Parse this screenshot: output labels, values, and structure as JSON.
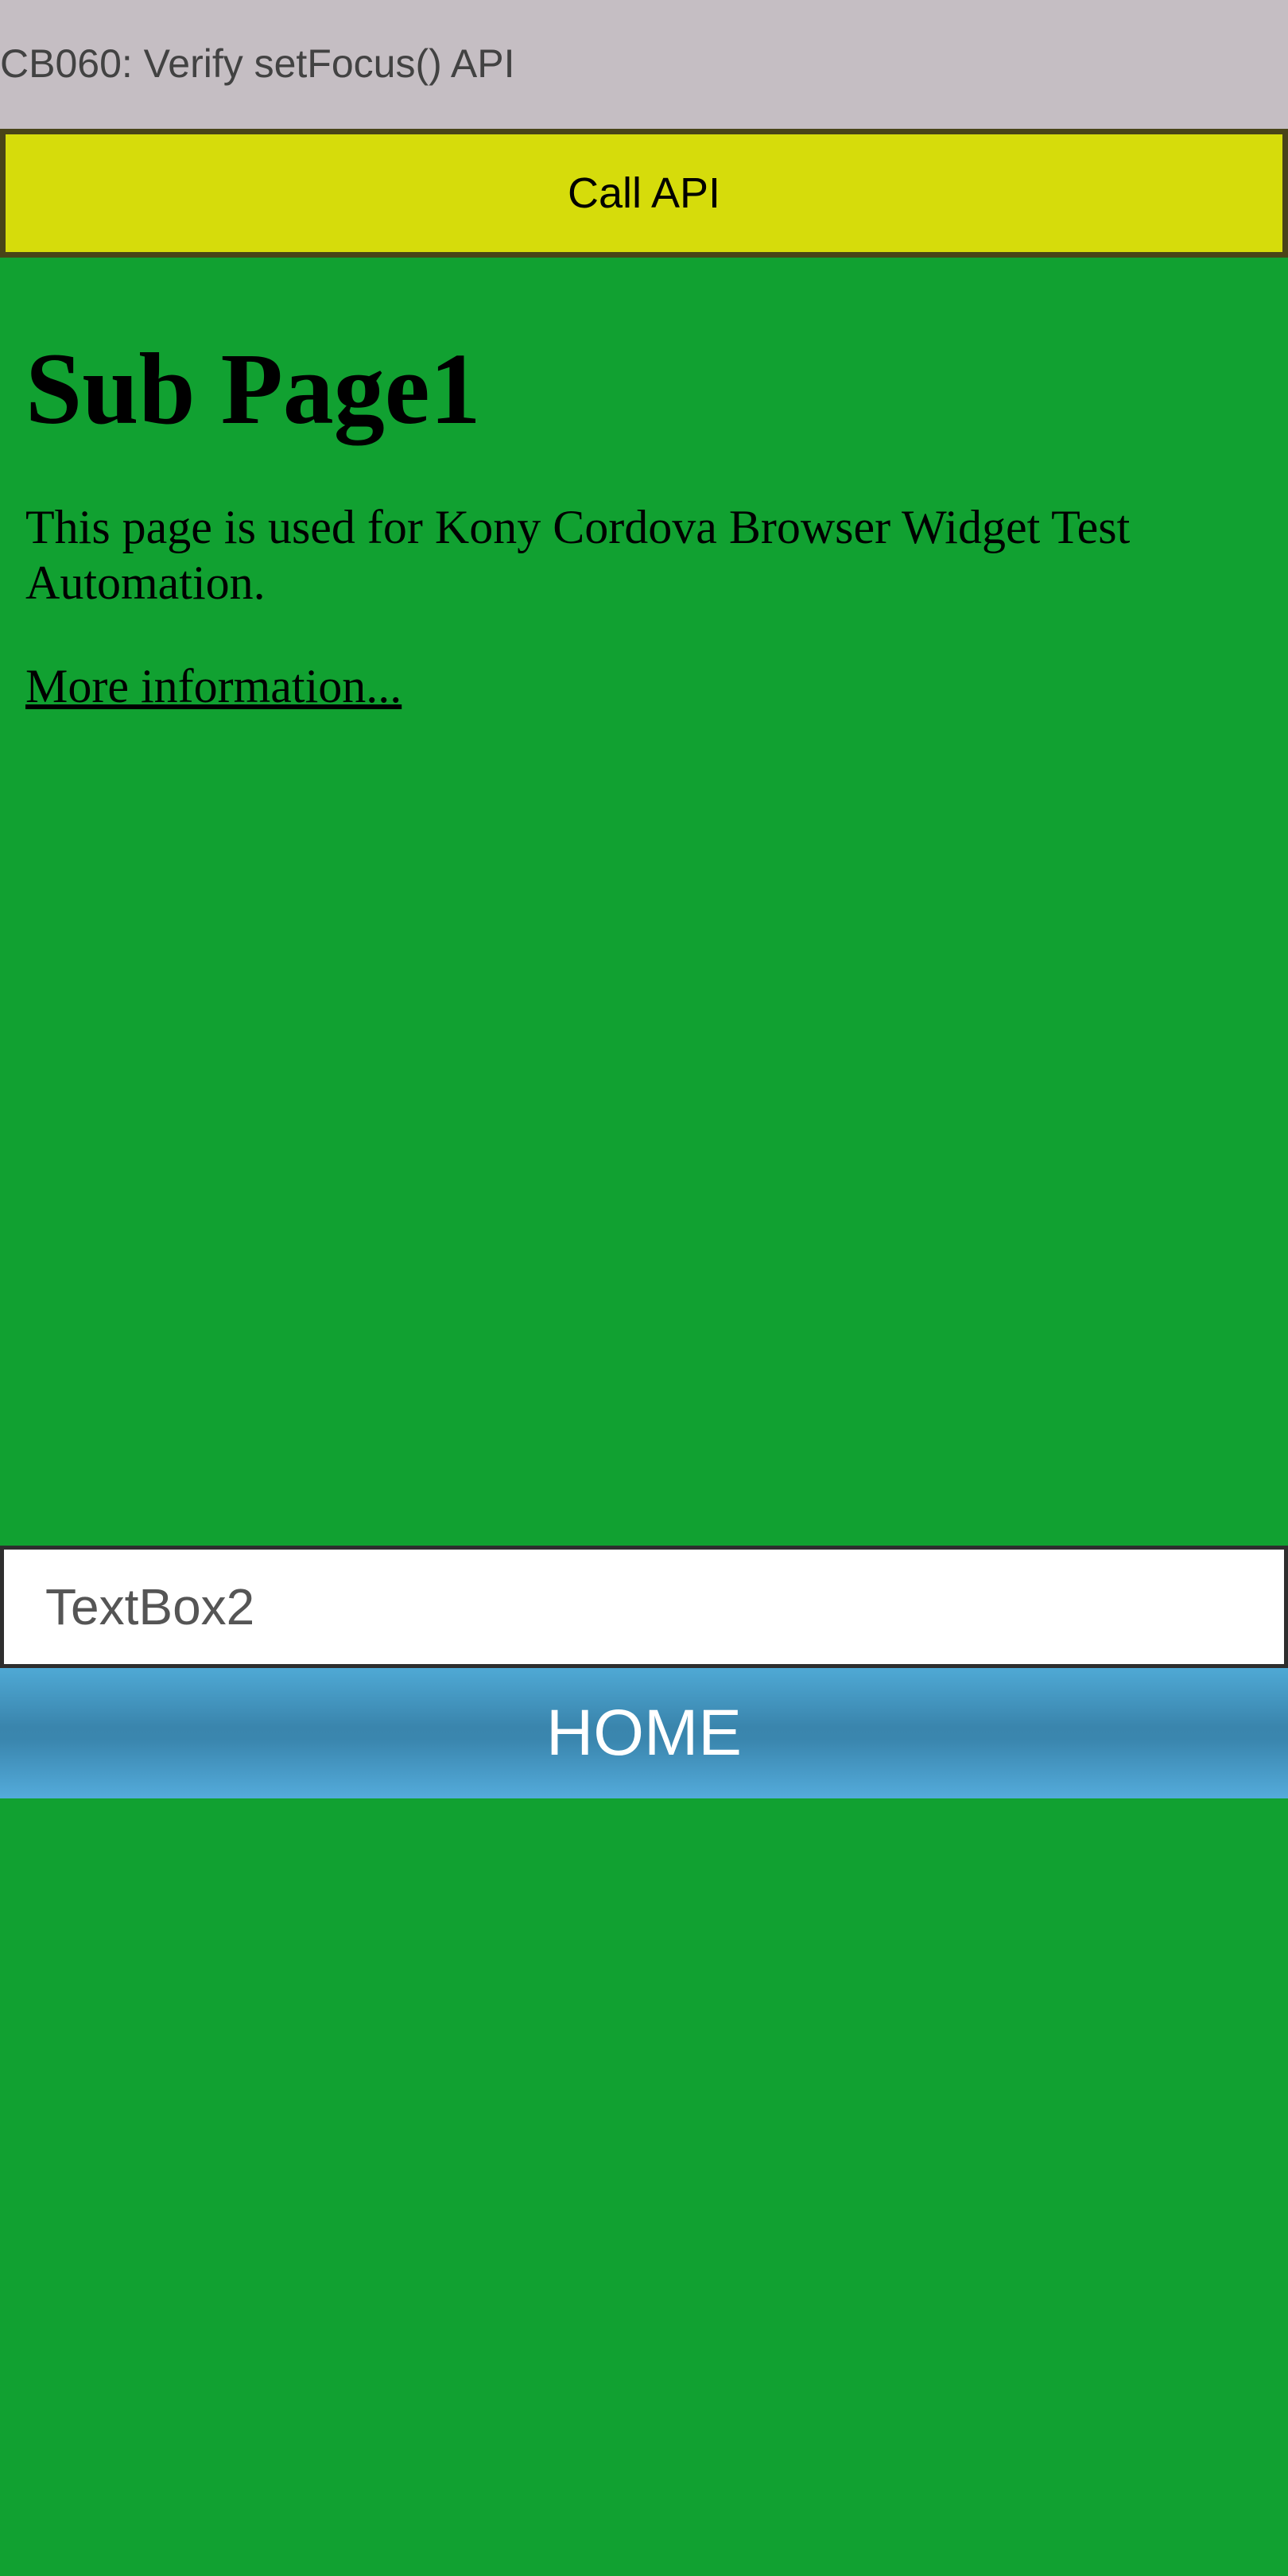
{
  "header": {
    "title": "CB060: Verify setFocus() API"
  },
  "toolbar": {
    "call_api_label": "Call API"
  },
  "browser": {
    "heading": "Sub Page1",
    "paragraph": "This page is used for Kony Cordova Browser Widget Test Automation.",
    "link_text": "More information..."
  },
  "form": {
    "textbox2_placeholder": "TextBox2",
    "textbox2_value": "",
    "home_label": "HOME"
  },
  "colors": {
    "background": "#11a131",
    "title_bar": "#c5bec3",
    "call_api_button": "#d6dc0b",
    "call_api_border": "#484418",
    "home_button": "#3a86ae",
    "home_text": "#ffffff"
  }
}
